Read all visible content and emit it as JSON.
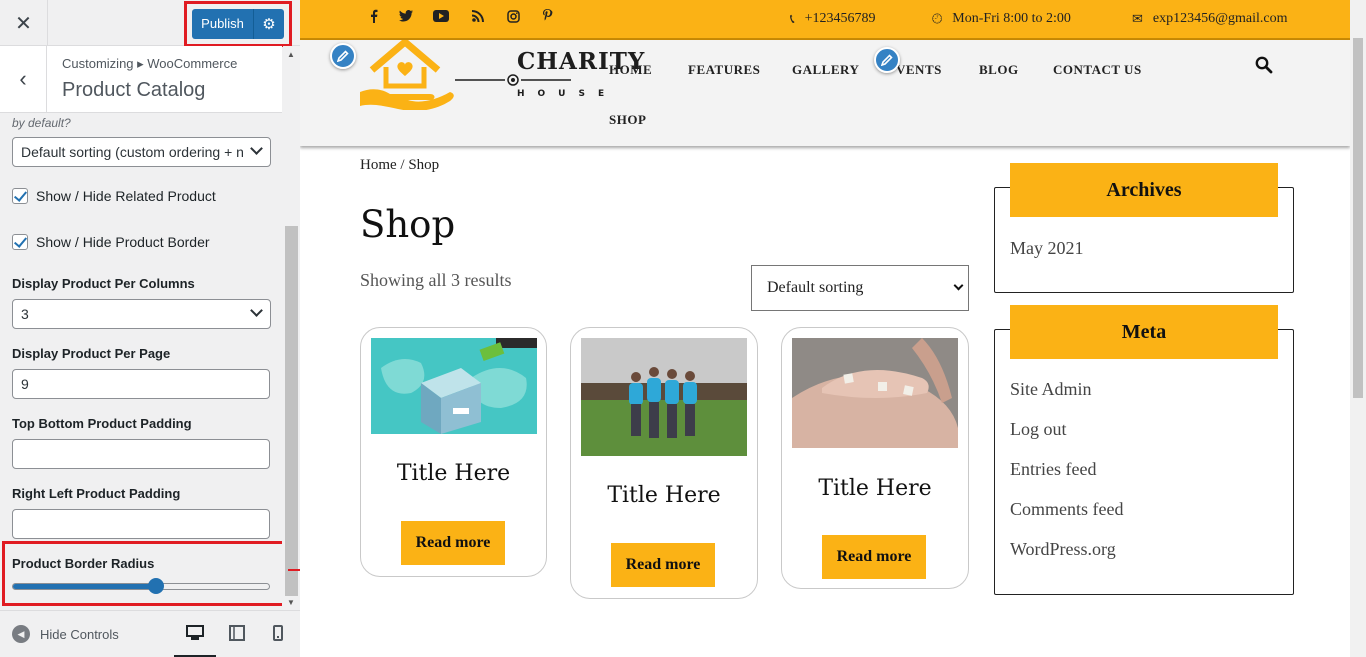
{
  "customizer": {
    "close_icon": "close-icon",
    "publish_label": "Publish",
    "breadcrumb": "Customizing ▸ WooCommerce",
    "panel_title": "Product Catalog",
    "default_sort_desc": "by default?",
    "default_sort_value": "Default sorting (custom ordering + n",
    "related_label": "Show / Hide Related Product",
    "related_checked": true,
    "border_label": "Show / Hide Product Border",
    "border_checked": true,
    "columns_label": "Display Product Per Columns",
    "columns_value": "3",
    "per_page_label": "Display Product Per Page",
    "per_page_value": "9",
    "tb_padding_label": "Top Bottom Product Padding",
    "tb_padding_value": "",
    "rl_padding_label": "Right Left Product Padding",
    "rl_padding_value": "",
    "radius_label": "Product Border Radius",
    "radius_fraction": 0.56,
    "hide_controls": "Hide Controls",
    "highlight_color": "#e01b22",
    "accent_color": "#2271b1"
  },
  "site": {
    "topbar": {
      "phone": "+123456789",
      "hours": "Mon-Fri 8:00 to 2:00",
      "email": "exp123456@gmail.com",
      "social_icons": [
        "facebook-icon",
        "twitter-icon",
        "youtube-icon",
        "rss-icon",
        "instagram-icon",
        "pinterest-icon"
      ]
    },
    "logo": {
      "name": "CHARITY",
      "sub": "HOUSE"
    },
    "nav": [
      "HOME",
      "FEATURES",
      "GALLERY",
      "EVENTS",
      "BLOG",
      "CONTACT US",
      "SHOP"
    ],
    "nav_events_visible": "VENTS",
    "breadcrumb": "Home / Shop",
    "page_title": "Shop",
    "result_count": "Showing all 3 results",
    "sort_value": "Default sorting",
    "products": [
      {
        "title": "Title Here",
        "button": "Read more",
        "image": "donation-box-image"
      },
      {
        "title": "Title Here",
        "button": "Read more",
        "image": "volunteers-image"
      },
      {
        "title": "Title Here",
        "button": "Read more",
        "image": "hands-image"
      }
    ],
    "sidebar": {
      "archives_title": "Archives",
      "archives": [
        "May 2021"
      ],
      "meta_title": "Meta",
      "meta": [
        "Site Admin",
        "Log out",
        "Entries feed",
        "Comments feed",
        "WordPress.org"
      ]
    },
    "accent_color": "#fbb215"
  }
}
